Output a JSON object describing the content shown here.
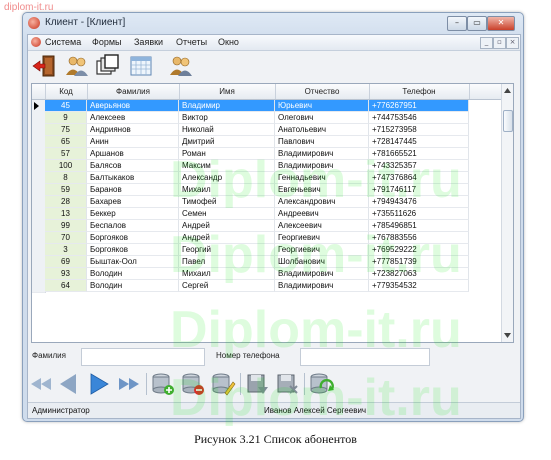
{
  "watermark_top": "diplom-it.ru",
  "watermark_big": "Diplom-it.ru",
  "window": {
    "title": "Клиент - [Клиент]"
  },
  "menu": [
    "Система",
    "Формы",
    "Заявки",
    "Отчеты",
    "Окно"
  ],
  "mdi_controls": [
    "_",
    "▫",
    "×"
  ],
  "window_controls": [
    "–",
    "▭",
    "✕"
  ],
  "toolbar_icons": [
    "exit-door-icon",
    "users-icon",
    "windows-icon",
    "calendar-table-icon",
    "users-search-icon"
  ],
  "table": {
    "columns": [
      "Код",
      "Фамилия",
      "Имя",
      "Отчество",
      "Телефон"
    ],
    "rows": [
      {
        "code": "45",
        "last": "Аверьянов",
        "first": "Владимир",
        "middle": "Юрьевич",
        "phone": "+776267951",
        "selected": true
      },
      {
        "code": "9",
        "last": "Алексеев",
        "first": "Виктор",
        "middle": "Олегович",
        "phone": "+744753546"
      },
      {
        "code": "75",
        "last": "Андриянов",
        "first": "Николай",
        "middle": "Анатольевич",
        "phone": "+715273958"
      },
      {
        "code": "65",
        "last": "Анин",
        "first": "Дмитрий",
        "middle": "Павлович",
        "phone": "+728147445"
      },
      {
        "code": "57",
        "last": "Аршанов",
        "first": "Роман",
        "middle": "Владимирович",
        "phone": "+781665521"
      },
      {
        "code": "100",
        "last": "Балясов",
        "first": "Максим",
        "middle": "Владимирович",
        "phone": "+743325357"
      },
      {
        "code": "8",
        "last": "Балтыкаков",
        "first": "Александр",
        "middle": "Геннадьевич",
        "phone": "+747376864"
      },
      {
        "code": "59",
        "last": "Баранов",
        "first": "Михаил",
        "middle": "Евгеньевич",
        "phone": "+791746117"
      },
      {
        "code": "28",
        "last": "Бахарев",
        "first": "Тимофей",
        "middle": "Александрович",
        "phone": "+794943476"
      },
      {
        "code": "13",
        "last": "Беккер",
        "first": "Семен",
        "middle": "Андреевич",
        "phone": "+735511626"
      },
      {
        "code": "99",
        "last": "Беспалов",
        "first": "Андрей",
        "middle": "Алексеевич",
        "phone": "+785496851"
      },
      {
        "code": "70",
        "last": "Боргояков",
        "first": "Андрей",
        "middle": "Георгиевич",
        "phone": "+767883556"
      },
      {
        "code": "3",
        "last": "Боргояков",
        "first": "Георгий",
        "middle": "Георгиевич",
        "phone": "+769529222"
      },
      {
        "code": "69",
        "last": "Быштак-Оол",
        "first": "Павел",
        "middle": "Шолбанович",
        "phone": "+777851739"
      },
      {
        "code": "93",
        "last": "Володин",
        "first": "Михаил",
        "middle": "Владимирович",
        "phone": "+723827063"
      },
      {
        "code": "64",
        "last": "Володин",
        "first": "Сергей",
        "middle": "Владимирович",
        "phone": "+779354532"
      }
    ]
  },
  "search": {
    "lastname_label": "Фамилия",
    "lastname_value": "",
    "phone_label": "Номер телефона",
    "phone_value": ""
  },
  "nav_icons": [
    "first-record-icon",
    "prev-record-icon",
    "next-record-icon",
    "last-record-icon",
    "add-record-icon",
    "delete-record-icon",
    "edit-record-icon",
    "save-icon",
    "cancel-save-icon",
    "refresh-icon"
  ],
  "status": {
    "role": "Администратор",
    "user": "Иванов Алексей Сергеевич"
  },
  "caption": "Рисунок 3.21 Список абонентов"
}
